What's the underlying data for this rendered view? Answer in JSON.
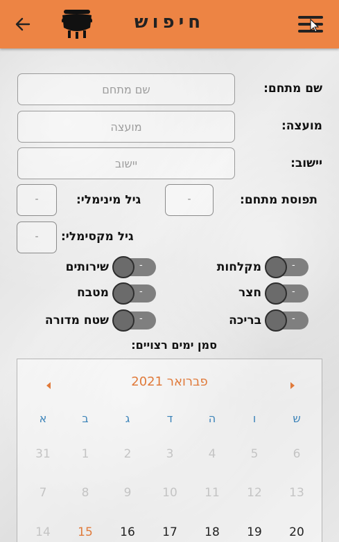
{
  "header": {
    "title": "חיפוש",
    "back_icon": "arrow-left-icon",
    "logo_icon": "pot-icon",
    "menu_icon": "hamburger-menu-icon",
    "color": "#ed8444"
  },
  "form": {
    "complex_name": {
      "label": "שם מתחם:",
      "placeholder": "שם מתחם",
      "value": ""
    },
    "council": {
      "label": "מועצה:",
      "placeholder": "מועצה",
      "value": ""
    },
    "settlement": {
      "label": "יישוב:",
      "placeholder": "יישוב",
      "value": ""
    },
    "capacity": {
      "label": "תפוסת מתחם:",
      "value": "-"
    },
    "min_age": {
      "label": "גיל מינימלי:",
      "value": "-"
    },
    "max_age": {
      "label": "גיל מקסימלי:",
      "value": "-"
    }
  },
  "toggles": {
    "showers": {
      "label": "מקלחות",
      "state": "-"
    },
    "toilets": {
      "label": "שירותים",
      "state": "-"
    },
    "yard": {
      "label": "חצר",
      "state": "-"
    },
    "kitchen": {
      "label": "מטבח",
      "state": "-"
    },
    "pool": {
      "label": "בריכה",
      "state": "-"
    },
    "campfire": {
      "label": "שטח מדורה",
      "state": "-"
    }
  },
  "calendar": {
    "prompt": "סמן ימים רצויים:",
    "month_label": "פברואר  2021",
    "accent": "#e07a3a",
    "weekday_color": "#3a82b8",
    "weekdays": [
      "ש",
      "ו",
      "ה",
      "ד",
      "ג",
      "ב",
      "א"
    ],
    "weeks": [
      [
        "6",
        "5",
        "4",
        "3",
        "2",
        "1",
        "31"
      ],
      [
        "13",
        "12",
        "11",
        "10",
        "9",
        "8",
        "7"
      ],
      [
        "20",
        "19",
        "18",
        "17",
        "16",
        "15",
        "14"
      ]
    ],
    "today": "15"
  }
}
